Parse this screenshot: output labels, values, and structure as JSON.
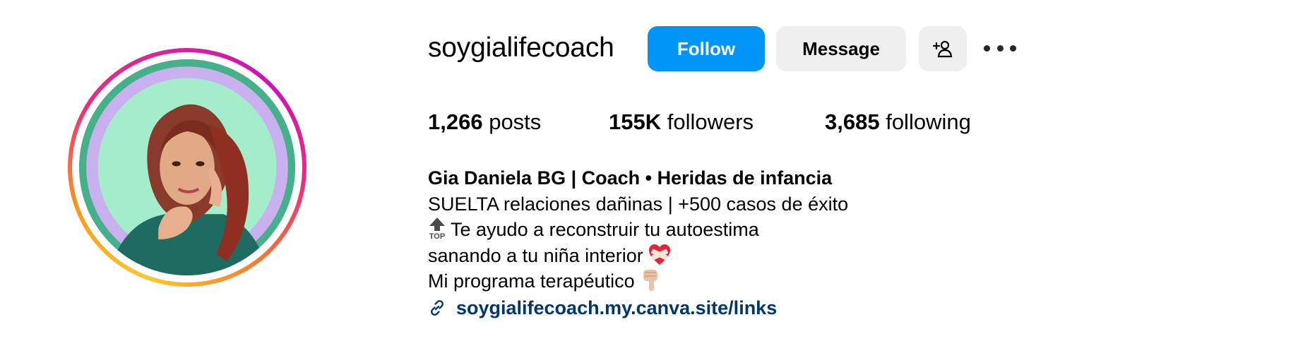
{
  "profile": {
    "username": "soygialifecoach",
    "follow_label": "Follow",
    "message_label": "Message"
  },
  "stats": {
    "posts_count": "1,266",
    "posts_label": "posts",
    "followers_count": "155K",
    "followers_label": "followers",
    "following_count": "3,685",
    "following_label": "following"
  },
  "bio": {
    "display_name": "Gia Daniela BG | Coach • Heridas de infancia",
    "line1": "SUELTA relaciones dañinas | +500 casos de éxito",
    "line2": "Te ayudo a reconstruir tu autoestima",
    "line3": "sanando a tu niña interior",
    "line4": "Mi programa terapéutico",
    "link": "soygialifecoach.my.canva.site/links"
  },
  "icons": {
    "add_user": "add-user-icon",
    "more": "more-options-icon",
    "link": "link-icon",
    "top_emoji": "top-arrow-emoji",
    "heart_emoji": "mending-heart-emoji",
    "pointing_emoji": "pointing-down-emoji"
  },
  "colors": {
    "follow_button": "#0095f6",
    "secondary_button": "#efefef",
    "link": "#00376b",
    "ring_start": "#fdc830",
    "ring_end": "#d6249f"
  }
}
